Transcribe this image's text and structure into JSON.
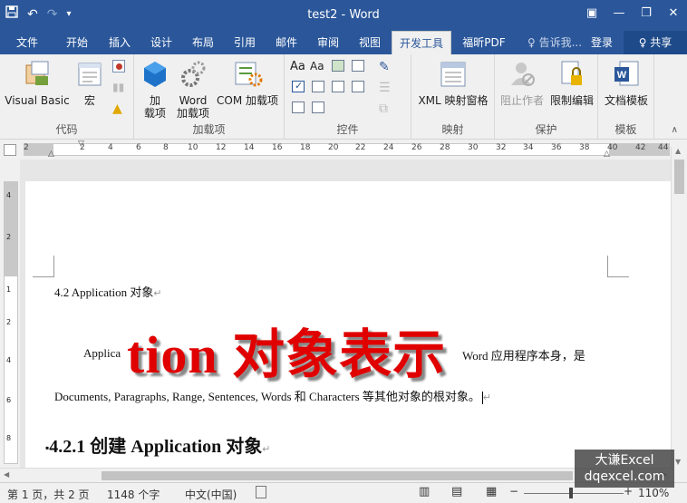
{
  "window": {
    "title": "test2 - Word",
    "qat": {
      "save_icon": "save-icon",
      "undo_glyph": "↶",
      "redo_glyph": "↷",
      "customize_glyph": "▾"
    },
    "controls": {
      "ribbon_display": "▣",
      "minimize": "—",
      "restore": "❐",
      "close": "✕"
    }
  },
  "tabs": [
    {
      "label": "文件",
      "active": false
    },
    {
      "label": "开始",
      "active": false
    },
    {
      "label": "插入",
      "active": false
    },
    {
      "label": "设计",
      "active": false
    },
    {
      "label": "布局",
      "active": false
    },
    {
      "label": "引用",
      "active": false
    },
    {
      "label": "邮件",
      "active": false
    },
    {
      "label": "审阅",
      "active": false
    },
    {
      "label": "视图",
      "active": false
    },
    {
      "label": "开发工具",
      "active": true
    },
    {
      "label": "福昕PDF",
      "active": false
    }
  ],
  "tell_me": "♀ 告诉我...",
  "login": "登录",
  "share": "♀ 共享",
  "ribbon": {
    "code": {
      "label": "代码",
      "visual_basic": "Visual Basic",
      "macros": "宏"
    },
    "addins": {
      "label": "加载项",
      "addins_line1": "加",
      "addins_line2": "载项",
      "word_line1": "Word",
      "word_line2": "加载项",
      "com": "COM 加载项"
    },
    "controls": {
      "label": "控件",
      "aa1": "Aa",
      "aa2": "Aa"
    },
    "mapping": {
      "label": "映射",
      "xml": "XML 映射窗格"
    },
    "protect": {
      "label": "保护",
      "block": "阻止作者",
      "restrict": "限制编辑"
    },
    "templates": {
      "label": "模板",
      "doc_template": "文档模板"
    }
  },
  "ruler": {
    "ticks": [
      "2",
      "2",
      "4",
      "6",
      "8",
      "10",
      "12",
      "14",
      "16",
      "18",
      "20",
      "22",
      "24",
      "26",
      "28",
      "30",
      "32",
      "34",
      "36",
      "38",
      "40",
      "42",
      "44"
    ]
  },
  "vruler": {
    "ticks": [
      "4",
      "2",
      "1",
      "2",
      "4",
      "6",
      "8",
      "10"
    ]
  },
  "document": {
    "heading_4_2": "4.2 Application  对象",
    "para_prefix": "Applica",
    "big_text": "tion  对象表示",
    "para_suffix": "Word 应用程序本身，是",
    "para_line2": "Documents, Paragraphs, Range, Sentences, Words 和 Characters 等其他对象的根对象。",
    "heading_4_2_1": "4.2.1  创建 Application 对象",
    "para_mark": "↵"
  },
  "status": {
    "page": "第 1 页，共 2 页",
    "words": "1148 个字",
    "language": "中文(中国)",
    "zoom": "110%"
  },
  "watermark": {
    "line1": "大谦Excel",
    "line2": "dqexcel.com"
  },
  "colors": {
    "brand": "#2b579a",
    "red_text": "#e00000"
  }
}
